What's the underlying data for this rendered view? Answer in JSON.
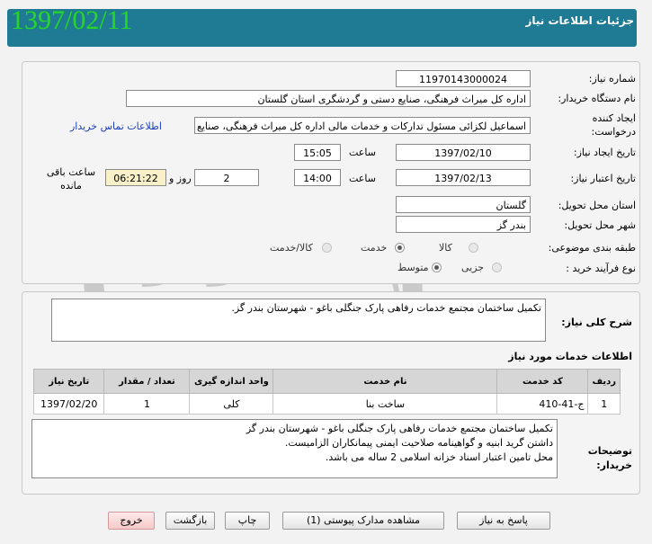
{
  "header": {
    "title": "جزئیات اطلاعات نیاز",
    "date": "1397/02/11"
  },
  "info": {
    "need_number_label": "شماره نیاز:",
    "need_number": "11970143000024",
    "buyer_org_label": "نام دستگاه خریدار:",
    "buyer_org": "اداره کل میراث فرهنگی، صنایع دستی و گردشگری استان گلستان",
    "creator_label": "ایجاد کننده درخواست:",
    "creator": "اسماعیل لکزائی مسئول تدارکات و خدمات مالی اداره کل میراث فرهنگی، صنایع",
    "contact_link": "اطلاعات تماس خریدار",
    "created_date_label": "تاریخ ایجاد نیاز:",
    "created_date": "1397/02/10",
    "time_label": "ساعت",
    "created_time": "15:05",
    "valid_date_label": "تاریخ اعتبار نیاز:",
    "valid_date": "1397/02/13",
    "valid_time": "14:00",
    "days_value": "2",
    "days_label": "روز و",
    "remaining_time": "06:21:22",
    "remaining_label": "ساعت باقی مانده",
    "province_label": "استان محل تحویل:",
    "province": "گلستان",
    "city_label": "شهر محل تحویل:",
    "city": "بندر گز",
    "category_label": "طبقه بندی موضوعی:",
    "category_options": [
      "کالا",
      "خدمت",
      "کالا/خدمت"
    ],
    "category_selected": "خدمت",
    "process_label": "نوع فرآیند خرید :",
    "process_options": [
      "جزیی",
      "متوسط"
    ],
    "process_selected": "متوسط"
  },
  "summary": {
    "label": "شرح کلی نیاز:",
    "text": "تکمیل ساختمان مجتمع خدمات رفاهی پارک جنگلی باغو - شهرستان بندر گز."
  },
  "services": {
    "title": "اطلاعات خدمات مورد نیاز",
    "columns": [
      "ردیف",
      "کد خدمت",
      "نام خدمت",
      "واحد اندازه گیری",
      "تعداد / مقدار",
      "تاریخ نیاز"
    ],
    "rows": [
      [
        "1",
        "ج-41-410",
        "ساخت بنا",
        "کلی",
        "1",
        "1397/02/20"
      ]
    ]
  },
  "buyer_notes": {
    "label": "توضیحات خریدار:",
    "lines": [
      "تکمیل ساختمان مجتمع خدمات رفاهی پارک جنگلی باغو - شهرستان بندر گز",
      "داشتن گرید ابنیه و گواهینامه صلاحیت ایمنی پیمانکاران الزامیست.",
      "محل تامین اعتبار اسناد خزانه اسلامی 2 ساله می باشد."
    ]
  },
  "buttons": {
    "respond": "پاسخ به نیاز",
    "view_docs": "مشاهده مدارک پیوستی (1)",
    "print": "چاپ",
    "back": "بازگشت",
    "exit": "خروج"
  },
  "watermark_text": [
    "هزاره",
    "ارتباط گستران"
  ],
  "colors": {
    "header_bg": "#1f7a93",
    "date_green": "#2bd22b",
    "link_blue": "#1a3fbf"
  }
}
